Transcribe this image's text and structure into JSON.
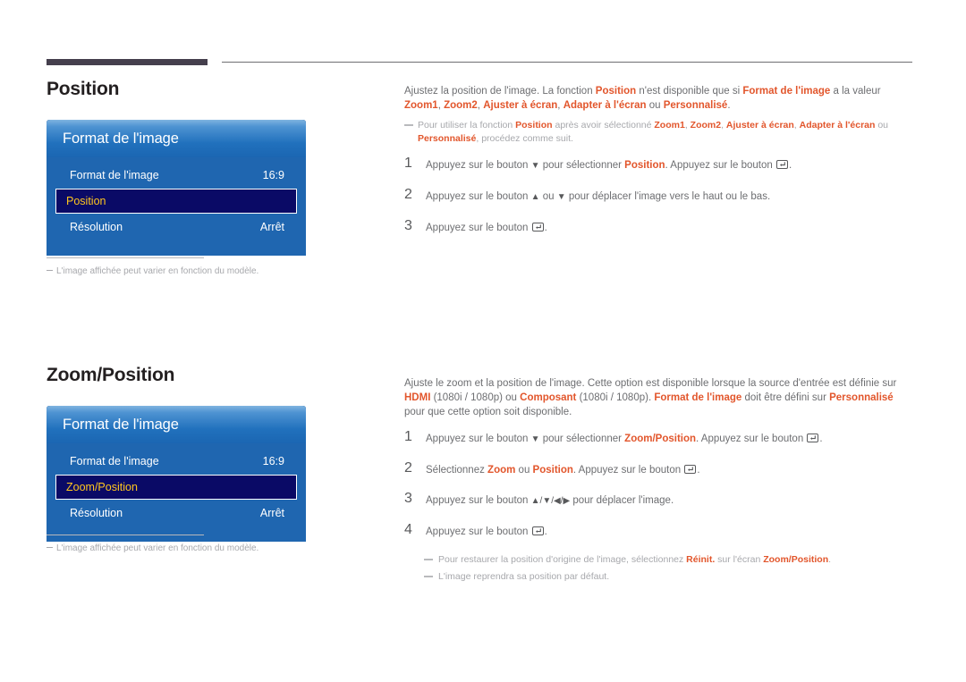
{
  "page": {
    "language": "fr",
    "accent_color": "#e2562c",
    "osd_panel_blue": "#1f66b0",
    "osd_selected_bg": "#0a0a66",
    "osd_selected_text": "#ffc61e"
  },
  "sections": [
    {
      "id": "position",
      "title": "Position",
      "osd": {
        "header": "Format de l'image",
        "rows": [
          {
            "label": "Format de l'image",
            "value": "16:9",
            "selected": false
          },
          {
            "label": "Position",
            "value": "",
            "selected": true
          },
          {
            "label": "Résolution",
            "value": "Arrêt",
            "selected": false
          }
        ]
      },
      "left_note": "L'image affichée peut varier en fonction du modèle.",
      "description": {
        "p1_a": "Ajustez la position de l'image. La fonction ",
        "p1_b": "Position",
        "p1_c": " n'est disponible que si ",
        "p1_d": "Format de l'image",
        "p1_e": " a la valeur ",
        "p1_f": "Zoom1",
        "p1_g": ", ",
        "p1_h": "Zoom2",
        "p1_i": ", ",
        "p1_j": "Ajuster à écran",
        "p1_k": ", ",
        "p1_l": "Adapter à l'écran",
        "p1_m": " ou ",
        "p1_n": "Personnalisé",
        "p1_o": "."
      },
      "note": {
        "a": "Pour utiliser la fonction ",
        "b": "Position",
        "c": " après avoir sélectionné ",
        "d": "Zoom1",
        "e": ", ",
        "f": "Zoom2",
        "g": ", ",
        "h": "Ajuster à écran",
        "i": ", ",
        "j": "Adapter à l'écran",
        "k": " ou ",
        "l": "Personnalisé",
        "m": ", procédez comme suit."
      },
      "steps": [
        {
          "num": "1",
          "t1": "Appuyez sur le bouton ",
          "arrow": "▼",
          "t2": " pour sélectionner ",
          "hl": "Position",
          "t3": ". Appuyez sur le bouton ",
          "icon": "enter-key-icon",
          "t4": "."
        },
        {
          "num": "2",
          "t1": "Appuyez sur le bouton ",
          "arrow": "▲",
          "t2": " ou ",
          "arrow2": "▼",
          "t3": " pour déplacer l'image vers le haut ou le bas.",
          "icon": "",
          "t4": ""
        },
        {
          "num": "3",
          "t1": "Appuyez sur le bouton ",
          "arrow": "",
          "t2": "",
          "hl": "",
          "t3": "",
          "icon": "enter-key-icon",
          "t4": "."
        }
      ]
    },
    {
      "id": "zoomposition",
      "title": "Zoom/Position",
      "osd": {
        "header": "Format de l'image",
        "rows": [
          {
            "label": "Format de l'image",
            "value": "16:9",
            "selected": false
          },
          {
            "label": "Zoom/Position",
            "value": "",
            "selected": true
          },
          {
            "label": "Résolution",
            "value": "Arrêt",
            "selected": false
          }
        ]
      },
      "left_note": "L'image affichée peut varier en fonction du modèle.",
      "description": {
        "p1_a": "Ajuste le zoom et la position de l'image. Cette option est disponible lorsque la source d'entrée est définie sur ",
        "p1_b": "HDMI",
        "p1_c": " (1080i / 1080p) ou ",
        "p1_d": "Composant",
        "p1_e": " (1080i / 1080p). ",
        "p1_f": "Format de l'image",
        "p1_g": " doit être défini sur ",
        "p1_h": "Personnalisé",
        "p1_i": " pour que cette option soit disponible."
      },
      "steps": [
        {
          "num": "1",
          "t1": "Appuyez sur le bouton ",
          "arrow": "▼",
          "t2": " pour sélectionner ",
          "hl": "Zoom/Position",
          "t3": ". Appuyez sur le bouton ",
          "icon": "enter-key-icon",
          "t4": "."
        },
        {
          "num": "2",
          "t1": "Sélectionnez ",
          "hl": "Zoom",
          "t2": " ou ",
          "hl2": "Position",
          "t3": ". Appuyez sur le bouton ",
          "icon": "enter-key-icon",
          "t4": "."
        },
        {
          "num": "3",
          "t1": "Appuyez sur le bouton ",
          "arrows": "▲/▼/◀/▶",
          "t3": " pour déplacer l'image.",
          "icon": "",
          "t4": ""
        },
        {
          "num": "4",
          "t1": "Appuyez sur le bouton ",
          "icon": "enter-key-icon",
          "t4": "."
        }
      ],
      "bottom_notes": [
        {
          "a": "Pour restaurer la position d'origine de l'image, sélectionnez ",
          "b": "Réinit.",
          "c": " sur l'écran ",
          "d": "Zoom/Position",
          "e": "."
        },
        {
          "a": "L'image reprendra sa position par défaut.",
          "b": "",
          "c": "",
          "d": "",
          "e": ""
        }
      ]
    }
  ]
}
